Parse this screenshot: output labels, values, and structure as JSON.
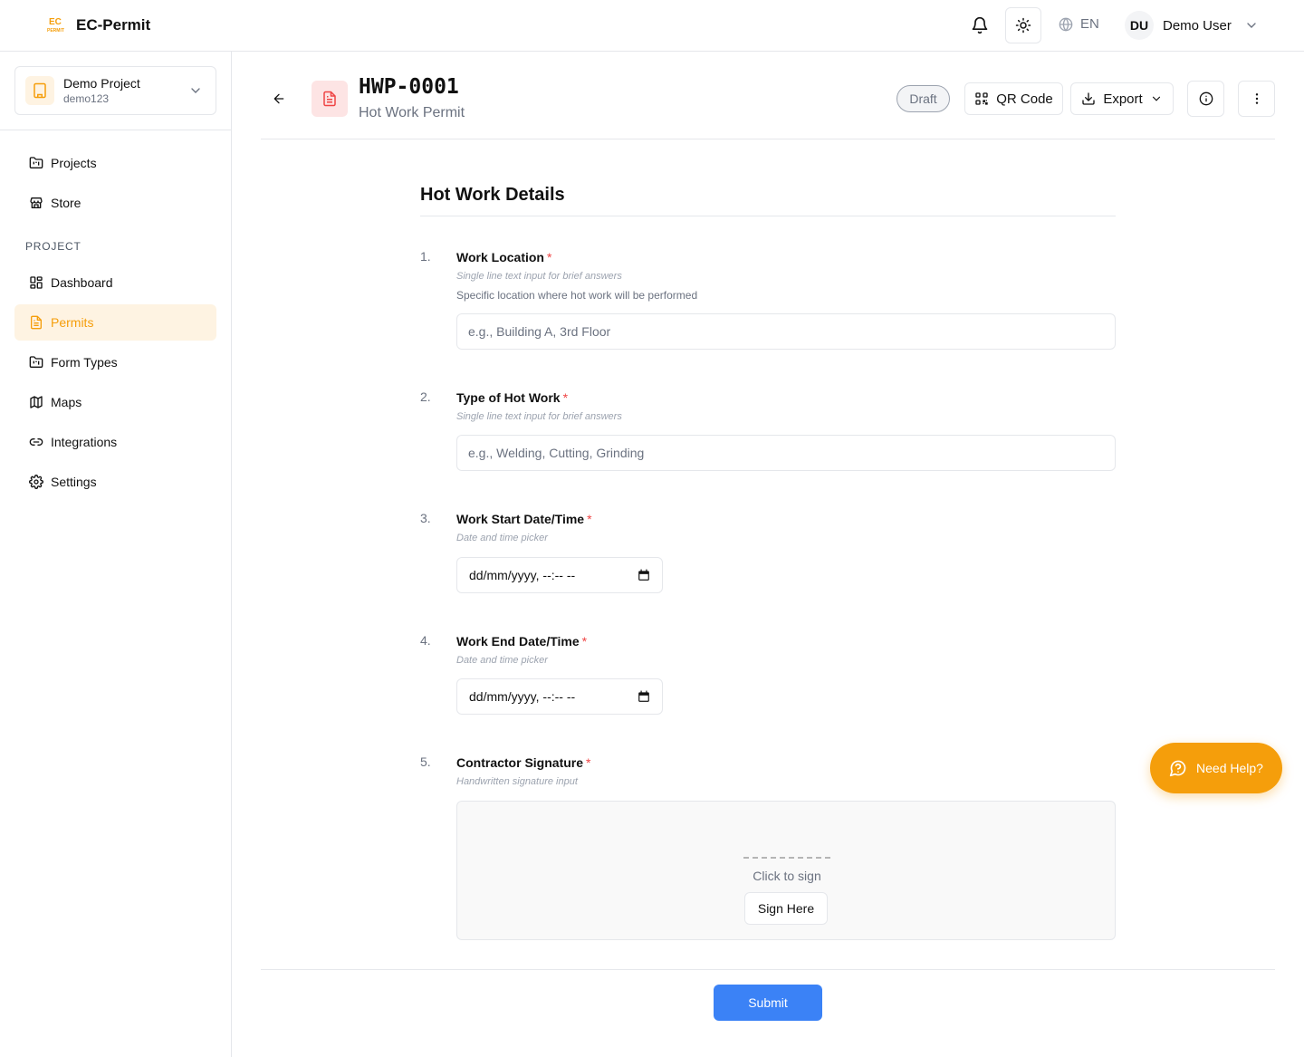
{
  "app": {
    "title": "EC-Permit",
    "logo_text": "EC PERMIT"
  },
  "topbar": {
    "language": "EN",
    "user": {
      "initials": "DU",
      "name": "Demo User"
    }
  },
  "sidebar": {
    "project": {
      "name": "Demo Project",
      "code": "demo123"
    },
    "top_items": [
      {
        "label": "Projects",
        "icon": "folder-icon"
      },
      {
        "label": "Store",
        "icon": "store-icon"
      }
    ],
    "section_label": "PROJECT",
    "project_items": [
      {
        "label": "Dashboard",
        "icon": "dashboard-icon"
      },
      {
        "label": "Permits",
        "icon": "file-text-icon",
        "active": true
      },
      {
        "label": "Form Types",
        "icon": "folder-icon"
      },
      {
        "label": "Maps",
        "icon": "map-icon"
      },
      {
        "label": "Integrations",
        "icon": "link-icon"
      },
      {
        "label": "Settings",
        "icon": "gear-icon"
      }
    ]
  },
  "header": {
    "permit_id": "HWP-0001",
    "permit_type": "Hot Work Permit",
    "status": "Draft",
    "qr_label": "QR Code",
    "export_label": "Export"
  },
  "form": {
    "title": "Hot Work Details",
    "questions": [
      {
        "number": "1.",
        "label": "Work Location",
        "required": "*",
        "hint": "Single line text input for brief answers",
        "description": "Specific location where hot work will be performed",
        "placeholder": "e.g., Building A, 3rd Floor"
      },
      {
        "number": "2.",
        "label": "Type of Hot Work",
        "required": "*",
        "hint": "Single line text input for brief answers",
        "placeholder": "e.g., Welding, Cutting, Grinding"
      },
      {
        "number": "3.",
        "label": "Work Start Date/Time",
        "required": "*",
        "hint": "Date and time picker",
        "value": "dd/mm/yyyy, --:-- --"
      },
      {
        "number": "4.",
        "label": "Work End Date/Time",
        "required": "*",
        "hint": "Date and time picker",
        "value": "dd/mm/yyyy, --:-- --"
      },
      {
        "number": "5.",
        "label": "Contractor Signature",
        "required": "*",
        "hint": "Handwritten signature input",
        "prompt": "Click to sign",
        "button": "Sign Here"
      }
    ],
    "submit_label": "Submit"
  },
  "help": {
    "label": "Need Help?"
  },
  "colors": {
    "accent": "#f59e0b",
    "primary": "#3b82f6",
    "required": "#ef4444",
    "active_bg": "#fef3e2",
    "doc_icon_bg": "#fde4e4"
  }
}
